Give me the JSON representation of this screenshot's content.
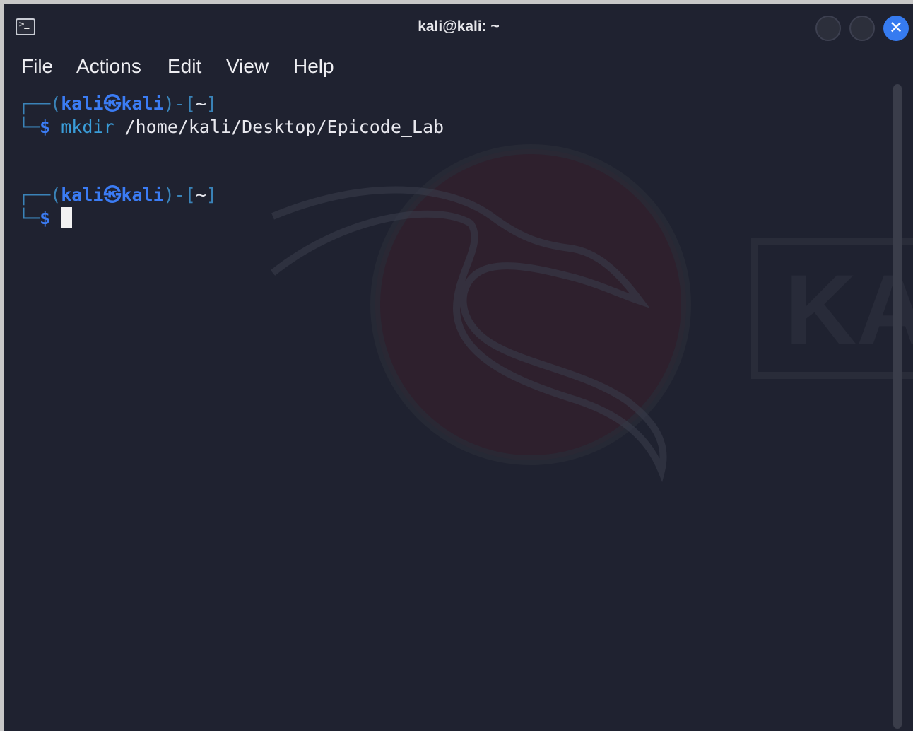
{
  "window": {
    "title": "kali@kali: ~"
  },
  "icons": {
    "app": "terminal-icon",
    "minimize": "minimize-icon",
    "maximize": "maximize-icon",
    "close": "close-icon",
    "close_glyph": "✕"
  },
  "menubar": {
    "items": [
      "File",
      "Actions",
      "Edit",
      "View",
      "Help"
    ]
  },
  "terminal": {
    "prompts": [
      {
        "top": "┌──(",
        "user": "kali",
        "at": "㉿",
        "host": "kali",
        "mid": ")-[",
        "dir": "~",
        "end": "]",
        "bottom": "└─",
        "dollar": "$",
        "command": "mkdir",
        "args": " /home/kali/Desktop/Epicode_Lab"
      },
      {
        "top": "┌──(",
        "user": "kali",
        "at": "㉿",
        "host": "kali",
        "mid": ")-[",
        "dir": "~",
        "end": "]",
        "bottom": "└─",
        "dollar": "$",
        "command": "",
        "args": ""
      }
    ]
  },
  "watermark_text": "KA",
  "colors": {
    "background": "#1f2230",
    "accent": "#367bf0",
    "prompt_user": "#3b7cf4",
    "prompt_frame": "#3a83b8"
  }
}
